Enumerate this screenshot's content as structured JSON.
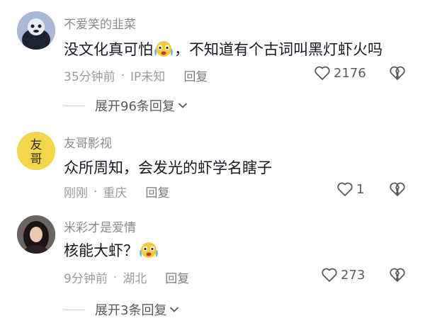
{
  "comments": [
    {
      "username": "不爱笑的韭菜",
      "text_before": "没文化真可怕",
      "emoji": "crying-laughing-emoji",
      "text_after": "，不知道有个古词叫黑灯虾火吗",
      "time": "35分钟前",
      "location": "IP未知",
      "reply_label": "回复",
      "likes": "2176",
      "expand_label": "展开96条回复"
    },
    {
      "username": "友哥影视",
      "avatar_text_1": "友",
      "avatar_text_2": "哥",
      "text_before": "众所周知，会发光的虾学名瞎子",
      "time": "刚刚",
      "location": "重庆",
      "reply_label": "回复",
      "likes": "1"
    },
    {
      "username": "米彩才是爱情",
      "text_before": "核能大虾？",
      "emoji": "crying-laughing-emoji",
      "time": "9分钟前",
      "location": "湖北",
      "reply_label": "回复",
      "likes": "273",
      "expand_label": "展开3条回复"
    }
  ],
  "colors": {
    "text": "#161823",
    "meta": "#9b9b9b",
    "avatar2_bg": "#f3d64b",
    "avatar1_bg": "#8fa3c6"
  }
}
